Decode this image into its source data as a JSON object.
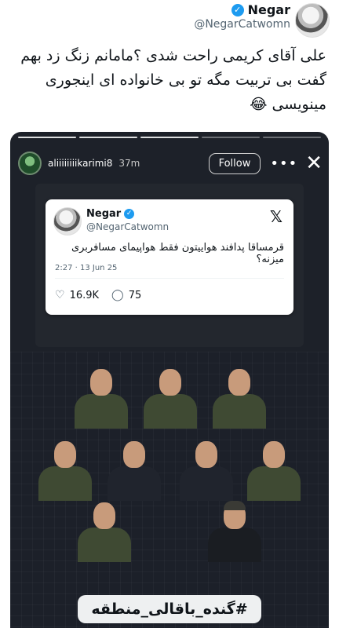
{
  "tweet": {
    "name": "Negar",
    "handle": "@NegarCatwomn",
    "verified_icon": "verified-badge-icon",
    "text": "علی آقای کریمی راحت شدی ؟مامانم زنگ زد بهم گفت بی تربیت مگه تو بی خانواده ای اینجوری مینویسی 😂"
  },
  "story": {
    "username": "aliiiiiiiikarimi8",
    "time": "37m",
    "follow_label": "Follow",
    "more_icon": "more-dots-icon",
    "close_icon": "close-icon",
    "progress_segments": 5,
    "progress_done": 3,
    "embedded_tweet": {
      "name": "Negar",
      "handle": "@NegarCatwomn",
      "text": "قرمساقا پدافند هواییتون فقط هواپیمای مسافربری میزنه؟",
      "meta": "2:27 · 13 Jun 25",
      "likes": "16.9K",
      "replies": "75",
      "logo_icon": "x-logo-icon"
    },
    "hashtag": "#گنده_باقالی_منطقه"
  },
  "colors": {
    "verified": "#1d9bf0",
    "story_bg": "#1d2129",
    "text_primary": "#0f1419",
    "text_secondary": "#536471"
  }
}
